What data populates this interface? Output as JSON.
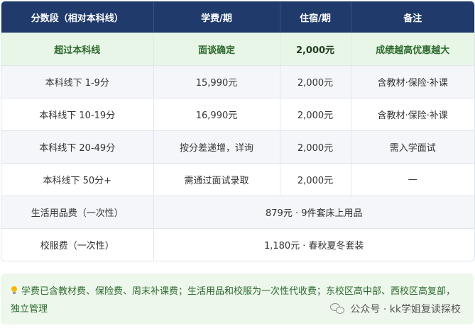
{
  "table": {
    "headers": [
      "分数段（相对本科线）",
      "学费/期",
      "住宿/期",
      "备注"
    ],
    "highlight_row": [
      "超过本科线",
      "面谈确定",
      "2,000元",
      "成绩越高优惠越大"
    ],
    "rows": [
      [
        "本科线下 1-9分",
        "15,990元",
        "2,000元",
        "含教材·保险·补课"
      ],
      [
        "本科线下 10-19分",
        "16,990元",
        "2,000元",
        "含教材·保险·补课"
      ],
      [
        "本科线下 20-49分",
        "按分差递增，详询",
        "2,000元",
        "需入学面试"
      ],
      [
        "本科线下 50分+",
        "需通过面试录取",
        "2,000元",
        "—"
      ]
    ],
    "fee_rows": [
      {
        "label": "生活用品费（一次性）",
        "value": "879元 · 9件套床上用品"
      },
      {
        "label": "校服费（一次性）",
        "value": "1,180元 · 春秋夏冬套装"
      }
    ]
  },
  "note": {
    "icon": "lightbulb-icon",
    "text": "学费已含教材费、保险费、周末补课费；生活用品和校服为一次性代收费；东校区高中部、西校区高复部，独立管理"
  },
  "watermark": {
    "icon": "wechat-icon",
    "text": "公众号 · kk学姐复读探校"
  },
  "colors": {
    "header_bg": "#1f3a6b",
    "highlight_bg": "#e8f6e8",
    "highlight_text": "#2d6a2d",
    "note_bg": "#edf7ec"
  }
}
